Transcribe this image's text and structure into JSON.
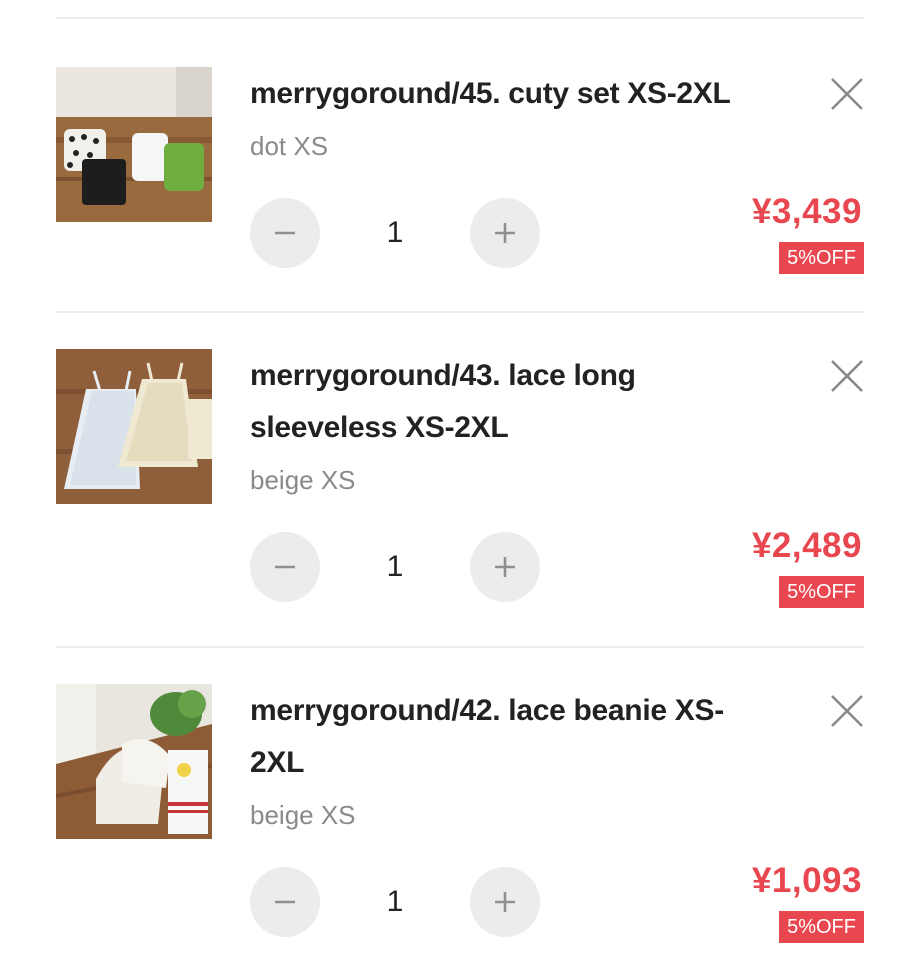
{
  "colors": {
    "price": "#e8474f",
    "badge_bg": "#e8474f",
    "title": "#222222",
    "variant": "#8a8a8a",
    "qty_button_bg": "#ececec"
  },
  "icons": {
    "remove": "close-icon",
    "decrease": "minus-icon",
    "increase": "plus-icon"
  },
  "cart": {
    "items": [
      {
        "title": "merrygoround/45. cuty set XS-2XL",
        "variant": "dot XS",
        "quantity": "1",
        "price": "¥3,439",
        "discount": "5%OFF"
      },
      {
        "title_line1": "merrygoround/43. lace long",
        "title_line2": "sleeveless XS-2XL",
        "variant": "beige XS",
        "quantity": "1",
        "price": "¥2,489",
        "discount": "5%OFF"
      },
      {
        "title_line1": "merrygoround/42. lace beanie XS-",
        "title_line2": "2XL",
        "variant": "beige XS",
        "quantity": "1",
        "price": "¥1,093",
        "discount": "5%OFF"
      }
    ]
  }
}
